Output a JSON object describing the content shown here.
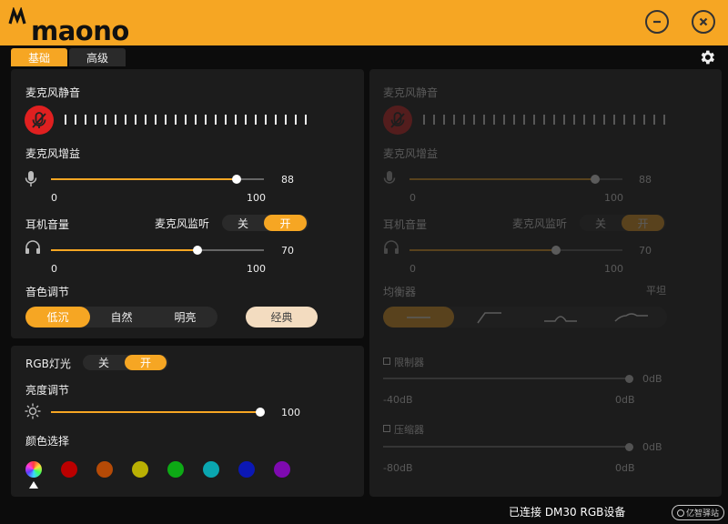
{
  "app": {
    "logo_text": "maono"
  },
  "tabs": [
    {
      "label": "基础",
      "active": true
    },
    {
      "label": "高级",
      "active": false
    }
  ],
  "left": {
    "mic_mute_label": "麦克风静音",
    "mic_gain_label": "麦克风增益",
    "mic_gain_value": "88",
    "mic_gain_fraction": 0.88,
    "mic_gain_min": "0",
    "mic_gain_max": "100",
    "headphone_label": "耳机音量",
    "monitor_label": "麦克风监听",
    "monitor_off": "关",
    "monitor_on": "开",
    "headphone_value": "70",
    "headphone_fraction": 0.7,
    "headphone_min": "0",
    "headphone_max": "100",
    "tone_label": "音色调节",
    "tone_options": [
      "低沉",
      "自然",
      "明亮"
    ],
    "tone_selected": "低沉",
    "classic_label": "经典"
  },
  "rgb": {
    "label": "RGB灯光",
    "off": "关",
    "on": "开",
    "brightness_label": "亮度调节",
    "brightness_value": "100",
    "brightness_fraction": 1.0,
    "color_label": "颜色选择",
    "colors": [
      "#bb0000",
      "#b54a06",
      "#b9b003",
      "#0daa15",
      "#0aa6b0",
      "#0b18b5",
      "#7e0ab0"
    ]
  },
  "right": {
    "mic_mute_label": "麦克风静音",
    "mic_gain_label": "麦克风增益",
    "mic_gain_value": "88",
    "mic_gain_min": "0",
    "mic_gain_max": "100",
    "headphone_label": "耳机音量",
    "monitor_label": "麦克风监听",
    "monitor_off": "关",
    "monitor_on": "开",
    "headphone_value": "70",
    "headphone_min": "0",
    "headphone_max": "100",
    "eq_label": "均衡器",
    "eq_preset": "平坦",
    "limiter_label": "限制器",
    "limiter_value": "0dB",
    "limiter_min": "-40dB",
    "limiter_max": "0dB",
    "compressor_label": "压缩器",
    "compressor_value": "0dB",
    "compressor_min": "-80dB",
    "compressor_max": "0dB"
  },
  "status": {
    "text": "已连接 DM30 RGB设备",
    "watermark": "亿智驿站"
  },
  "colors": {
    "accent": "#f6a623",
    "panel": "#1c1c1c",
    "background": "#0c0c0c",
    "mute_red": "#e02020"
  }
}
